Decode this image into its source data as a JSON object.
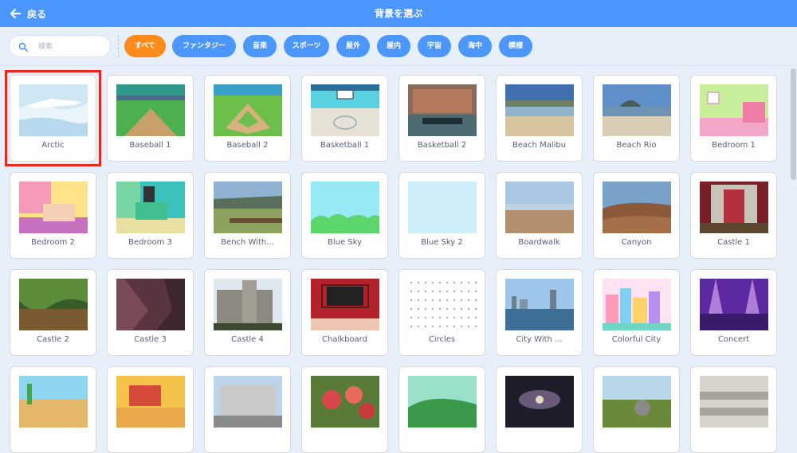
{
  "header": {
    "back_label": "戻る",
    "title": "背景を選ぶ"
  },
  "search": {
    "placeholder": "検索",
    "value": ""
  },
  "tags": [
    {
      "label": "すべて",
      "active": true
    },
    {
      "label": "ファンタジー",
      "active": false
    },
    {
      "label": "音楽",
      "active": false
    },
    {
      "label": "スポーツ",
      "active": false
    },
    {
      "label": "屋外",
      "active": false
    },
    {
      "label": "屋内",
      "active": false
    },
    {
      "label": "宇宙",
      "active": false
    },
    {
      "label": "海中",
      "active": false
    },
    {
      "label": "模様",
      "active": false
    }
  ],
  "backdrops": [
    {
      "label": "Arctic",
      "selected": true
    },
    {
      "label": "Baseball 1"
    },
    {
      "label": "Baseball 2"
    },
    {
      "label": "Basketball 1"
    },
    {
      "label": "Basketball 2"
    },
    {
      "label": "Beach Malibu"
    },
    {
      "label": "Beach Rio"
    },
    {
      "label": "Bedroom 1"
    },
    {
      "label": "Bedroom 2"
    },
    {
      "label": "Bedroom 3"
    },
    {
      "label": "Bench With..."
    },
    {
      "label": "Blue Sky"
    },
    {
      "label": "Blue Sky 2"
    },
    {
      "label": "Boardwalk"
    },
    {
      "label": "Canyon"
    },
    {
      "label": "Castle 1"
    },
    {
      "label": "Castle 2"
    },
    {
      "label": "Castle 3"
    },
    {
      "label": "Castle 4"
    },
    {
      "label": "Chalkboard"
    },
    {
      "label": "Circles"
    },
    {
      "label": "City With ..."
    },
    {
      "label": "Colorful City"
    },
    {
      "label": "Concert"
    },
    {
      "label": ""
    },
    {
      "label": ""
    },
    {
      "label": ""
    },
    {
      "label": ""
    },
    {
      "label": ""
    },
    {
      "label": ""
    },
    {
      "label": ""
    },
    {
      "label": ""
    }
  ],
  "colors": {
    "header_blue": "#4c97ff",
    "active_tag": "#ff8c1a",
    "selection_outline": "#e8281c"
  }
}
